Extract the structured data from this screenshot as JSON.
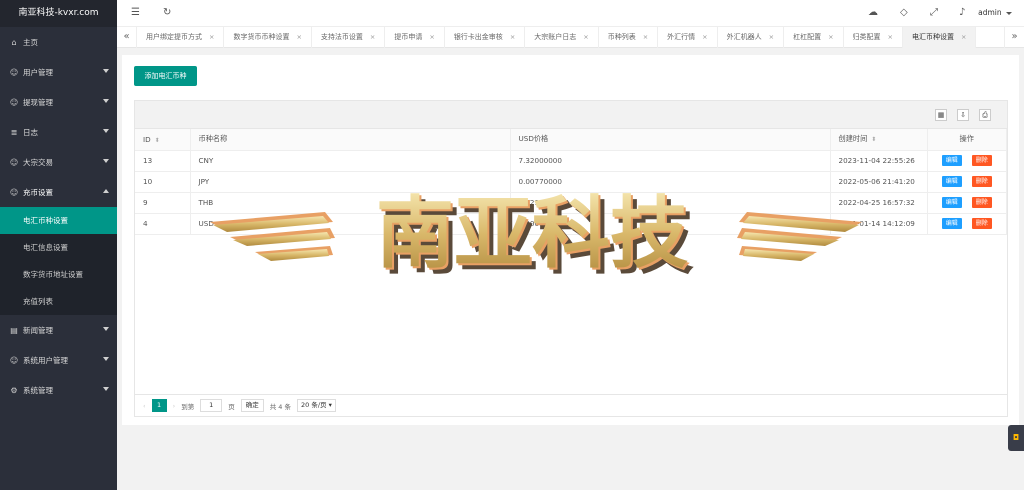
{
  "brand": "南亚科技-kvxr.com",
  "sidebar": {
    "items": [
      {
        "label": "主页",
        "icon": "home-icon",
        "glyph": "⌂",
        "caret": ""
      },
      {
        "label": "用户管理",
        "icon": "user-icon",
        "glyph": "☺",
        "caret": "down"
      },
      {
        "label": "提现管理",
        "icon": "user-icon",
        "glyph": "☺",
        "caret": "down"
      },
      {
        "label": "日志",
        "icon": "list-icon",
        "glyph": "≣",
        "caret": "down"
      },
      {
        "label": "大宗交易",
        "icon": "user-icon",
        "glyph": "☺",
        "caret": "down"
      },
      {
        "label": "充币设置",
        "icon": "user-icon",
        "glyph": "☺",
        "caret": "up"
      }
    ],
    "sub_items": [
      {
        "label": "电汇币种设置",
        "active": true
      },
      {
        "label": "电汇信息设置",
        "active": false
      },
      {
        "label": "数字货币地址设置",
        "active": false
      },
      {
        "label": "充值列表",
        "active": false
      }
    ],
    "items_after": [
      {
        "label": "新闻管理",
        "icon": "news-icon",
        "glyph": "▤",
        "caret": "down"
      },
      {
        "label": "系统用户管理",
        "icon": "user-icon",
        "glyph": "☺",
        "caret": "down"
      },
      {
        "label": "系统管理",
        "icon": "gear-icon",
        "glyph": "⚙",
        "caret": "down"
      }
    ]
  },
  "topbar": {
    "user": "admin"
  },
  "tabs": [
    {
      "label": "用户绑定提币方式",
      "active": false
    },
    {
      "label": "数字货币币种设置",
      "active": false
    },
    {
      "label": "支持法币设置",
      "active": false
    },
    {
      "label": "提币申请",
      "active": false
    },
    {
      "label": "银行卡出金审核",
      "active": false
    },
    {
      "label": "大宗账户日志",
      "active": false
    },
    {
      "label": "币种列表",
      "active": false
    },
    {
      "label": "外汇行情",
      "active": false
    },
    {
      "label": "外汇机器人",
      "active": false
    },
    {
      "label": "杠杠配置",
      "active": false
    },
    {
      "label": "归类配置",
      "active": false
    },
    {
      "label": "电汇币种设置",
      "active": true
    }
  ],
  "main": {
    "add_button": "添加电汇币种"
  },
  "table": {
    "columns": [
      "ID",
      "币种名称",
      "USD价格",
      "创建时间",
      "操作"
    ],
    "rows": [
      {
        "id": "13",
        "name": "CNY",
        "price": "7.32000000",
        "created": "2023-11-04 22:55:26"
      },
      {
        "id": "10",
        "name": "JPY",
        "price": "0.00770000",
        "created": "2022-05-06 21:41:20"
      },
      {
        "id": "9",
        "name": "THB",
        "price": "0.02930000",
        "created": "2022-04-25 16:57:32"
      },
      {
        "id": "4",
        "name": "USD",
        "price": "1.00000000",
        "created": "2021-01-14 14:12:09"
      }
    ],
    "edit_label": "编辑",
    "delete_label": "删除"
  },
  "pager": {
    "current_page": "1",
    "goto_label": "到第",
    "page_input": "1",
    "page_suffix": "页",
    "confirm": "确定",
    "total": "共 4 条",
    "per_page": "20 条/页"
  },
  "watermark": {
    "text": "南亚科技"
  },
  "colors": {
    "accent": "#009688",
    "sidebar_bg": "#2b2f3a",
    "edit": "#1e9fff",
    "delete": "#ff5722"
  }
}
